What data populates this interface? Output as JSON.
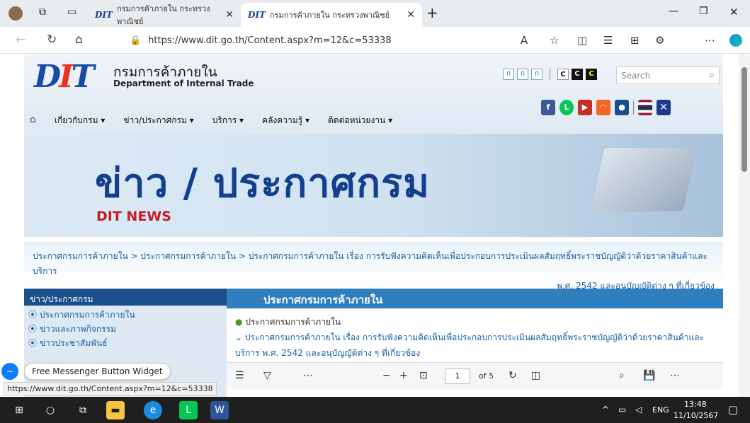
{
  "browser": {
    "tabs": [
      {
        "title": "กรมการค้าภายใน กระทรวงพาณิชย์"
      },
      {
        "title": "กรมการค้าภายใน กระทรวงพาณิชย์"
      }
    ],
    "url": "https://www.dit.go.th/Content.aspx?m=12&c=53338",
    "status_url": "https://www.dit.go.th/Content.aspx?m=12&c=53338"
  },
  "site": {
    "logo_text": "DIT",
    "name_th": "กรมการค้าภายใน",
    "name_en": "Department of Internal Trade",
    "menu": [
      "เกี่ยวกับกรม ▾",
      "ข่าว/ประกาศกรม ▾",
      "บริการ ▾",
      "คลังความรู้ ▾",
      "ติดต่อหน่วยงาน ▾"
    ],
    "font_buttons": [
      "ก",
      "ก",
      "ก"
    ],
    "contrast_buttons": [
      "C",
      "C",
      "C"
    ],
    "search_placeholder": "Search"
  },
  "banner": {
    "title": "ข่าว / ประกาศกรม",
    "subtitle": "DIT NEWS"
  },
  "breadcrumb": {
    "line1": "ประกาศกรมการค้าภายใน > ประกาศกรมการค้าภายใน > ประกาศกรมการค้าภายใน เรื่อง การรับฟังความคิดเห็นเพื่อประกอบการประเมินผลสัมฤทธิ์พระราชบัญญัติว่าด้วยราคาสินค้าและบริการ",
    "line2": "พ.ศ. 2542 และอนุบัญญัติต่าง ๆ ที่เกี่ยวข้อง"
  },
  "sidebar": {
    "title": "ข่าว/ประกาศกรม",
    "items": [
      "ประกาศกรมการค้าภายใน",
      "ข่าวและภาพกิจกรรม",
      "ข่าวประชาสัมพันธ์"
    ]
  },
  "content": {
    "heading": "ประกาศกรมการค้าภายใน",
    "category": "ประกาศกรมการค้าภายใน",
    "doc_title_1": "ประกาศกรมการค้าภายใน เรื่อง การรับฟังความคิดเห็นเพื่อประกอบการประเมินผลสัมฤทธิ์พระราชบัญญัติว่าด้วยราคาสินค้าและ",
    "doc_title_2": "บริการ พ.ศ. 2542 และอนุบัญญัติต่าง ๆ ที่เกี่ยวข้อง"
  },
  "pdf": {
    "page": "1",
    "of_pages": "of 5"
  },
  "messenger": {
    "label": "Free Messenger Button Widget"
  },
  "taskbar": {
    "lang": "ENG",
    "time": "13:48",
    "date": "11/10/2567"
  }
}
